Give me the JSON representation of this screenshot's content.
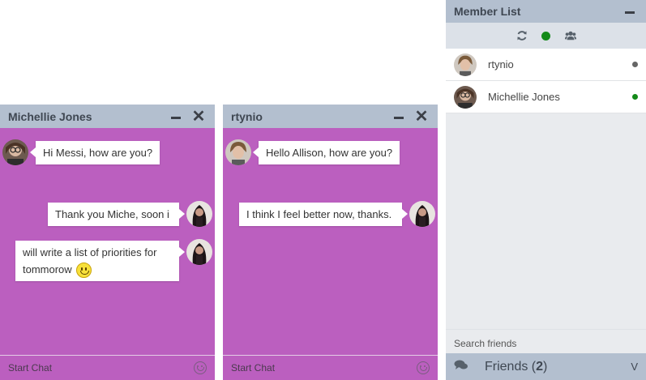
{
  "chat_windows": [
    {
      "title": "Michellie Jones",
      "footer_placeholder": "Start Chat",
      "messages": [
        {
          "text": "Hi Messi, how are you?"
        },
        {
          "text": "Thank you Miche, soon i"
        },
        {
          "text": "will write a list of priorities for tommorow"
        }
      ]
    },
    {
      "title": "rtynio",
      "footer_placeholder": "Start Chat",
      "messages": [
        {
          "text": "Hello Allison, how are you?"
        },
        {
          "text": "I think I feel better now, thanks."
        }
      ]
    }
  ],
  "member_list": {
    "title": "Member List",
    "toolbar_icons": [
      "refresh-icon",
      "online-status-icon",
      "group-icon"
    ],
    "members": [
      {
        "name": "rtynio",
        "status": "offline",
        "status_color": "#666666"
      },
      {
        "name": "Michellie Jones",
        "status": "online",
        "status_color": "#138a19"
      }
    ],
    "search_placeholder": "Search friends",
    "friends_label": "Friends",
    "friends_count": "2"
  },
  "colors": {
    "chat_background": "#bb5fbf",
    "header_background": "#b3bfcf",
    "online": "#138a19"
  }
}
